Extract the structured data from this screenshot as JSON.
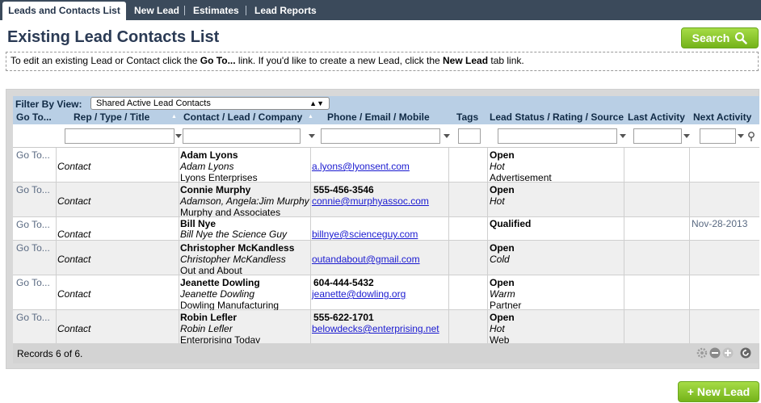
{
  "tabs": [
    {
      "label": "Leads and Contacts List",
      "active": true
    },
    {
      "label": "New Lead"
    },
    {
      "label": "Estimates"
    },
    {
      "label": "Lead Reports"
    }
  ],
  "page_title": "Existing Lead Contacts List",
  "search_label": "Search",
  "info": {
    "p1": "To edit an existing Lead or Contact click the ",
    "b1": "Go To...",
    "p2": " link.  If you'd like to create a new Lead, click the ",
    "b2": "New Lead",
    "p3": " tab link."
  },
  "filter": {
    "label": "Filter By View:",
    "selected": "Shared Active Lead Contacts"
  },
  "columns": [
    "Go To...",
    "Rep / Type / Title",
    "Contact / Lead / Company",
    "Phone / Email / Mobile",
    "Tags",
    "Lead Status / Rating / Source",
    "Last Activity",
    "Next Activity"
  ],
  "rows": [
    {
      "goto": "Go To...",
      "type": "Contact",
      "name": "Adam Lyons",
      "lead": "Adam Lyons",
      "company": "Lyons Enterprises",
      "phone": "",
      "email": "a.lyons@lyonsent.com",
      "status": "Open",
      "rating": "Hot",
      "source": "Advertisement",
      "next": ""
    },
    {
      "goto": "Go To...",
      "type": "Contact",
      "name": "Connie Murphy",
      "lead": "Adamson, Angela:Jim Murphy",
      "company": "Murphy and Associates",
      "phone": "555-456-3546",
      "email": "connie@murphyassoc.com",
      "status": "Open",
      "rating": "Hot",
      "source": "",
      "next": ""
    },
    {
      "goto": "Go To...",
      "type": "Contact",
      "name": "Bill Nye",
      "lead": "Bill Nye the Science Guy",
      "company": "",
      "phone": "",
      "email": "billnye@scienceguy.com",
      "status": "Qualified",
      "rating": "",
      "source": "",
      "next": "Nov-28-2013"
    },
    {
      "goto": "Go To...",
      "type": "Contact",
      "name": "Christopher McKandless",
      "lead": "Christopher McKandless",
      "company": "Out and About",
      "phone": "",
      "email": "outandabout@gmail.com",
      "status": "Open",
      "rating": "Cold",
      "source": "",
      "next": ""
    },
    {
      "goto": "Go To...",
      "type": "Contact",
      "name": "Jeanette Dowling",
      "lead": "Jeanette Dowling",
      "company": "Dowling Manufacturing",
      "phone": "604-444-5432",
      "email": "jeanette@dowling.org",
      "status": "Open",
      "rating": "Warm",
      "source": "Partner",
      "next": ""
    },
    {
      "goto": "Go To...",
      "type": "Contact",
      "name": "Robin Lefler",
      "lead": "Robin Lefler",
      "company": "Enterprising Today",
      "phone": "555-622-1701",
      "email": "belowdecks@enterprising.net",
      "status": "Open",
      "rating": "Hot",
      "source": "Web",
      "next": ""
    }
  ],
  "records_text": "Records 6 of 6.",
  "new_lead_label": "+ New Lead"
}
